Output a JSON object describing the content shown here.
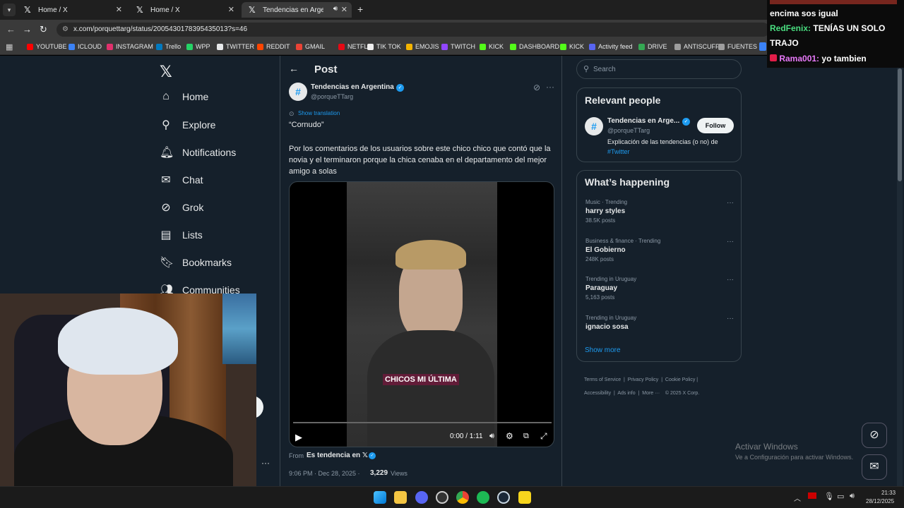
{
  "browser": {
    "tabs": [
      {
        "title": "Home / X",
        "icon": "x-logo"
      },
      {
        "title": "Home / X",
        "icon": "x-logo"
      },
      {
        "title": "Tendencias en Argentina on",
        "icon": "x-logo",
        "active": true
      }
    ],
    "new_tab": "+",
    "url": "x.com/porquettarg/status/2005430178395435013?s=46",
    "bookmarks": [
      {
        "label": "YOUTUBE",
        "color": "#ff0000"
      },
      {
        "label": "ICLOUD",
        "color": "#3b82f6"
      },
      {
        "label": "INSTAGRAM",
        "color": "#e1306c"
      },
      {
        "label": "Trello",
        "color": "#0079bf"
      },
      {
        "label": "WPP",
        "color": "#25d366"
      },
      {
        "label": "TWITTER",
        "color": "#e7e9ea"
      },
      {
        "label": "REDDIT",
        "color": "#ff4500"
      },
      {
        "label": "GMAIL",
        "color": "#ea4335"
      },
      {
        "label": "NETFLIX",
        "color": "#e50914"
      },
      {
        "label": "TIK TOK",
        "color": "#eeeeee"
      },
      {
        "label": "EMOJIS",
        "color": "#f4b400"
      },
      {
        "label": "TWITCH",
        "color": "#9146ff"
      },
      {
        "label": "KICK",
        "color": "#53fc18"
      },
      {
        "label": "DASHBOARD",
        "color": "#53fc18"
      },
      {
        "label": "KICK",
        "color": "#53fc18"
      },
      {
        "label": "Activity feed",
        "color": "#5865f2"
      },
      {
        "label": "DRIVE",
        "color": "#34a853"
      },
      {
        "label": "ANTISCUFF",
        "color": "#9e9e9e"
      },
      {
        "label": "FUENTES",
        "color": "#9e9e9e"
      }
    ]
  },
  "sidebar": {
    "items": [
      {
        "label": "Home",
        "icon": "home-icon"
      },
      {
        "label": "Explore",
        "icon": "search-icon"
      },
      {
        "label": "Notifications",
        "icon": "bell-icon"
      },
      {
        "label": "Chat",
        "icon": "mail-icon"
      },
      {
        "label": "Grok",
        "icon": "grok-icon"
      },
      {
        "label": "Lists",
        "icon": "list-icon"
      },
      {
        "label": "Bookmarks",
        "icon": "bookmark-icon"
      },
      {
        "label": "Communities",
        "icon": "people-icon"
      }
    ],
    "more": "···"
  },
  "post": {
    "header": "Post",
    "author_name": "Tendencias en Argentina",
    "author_handle": "@porqueTTarg",
    "show_translation": "Show translation",
    "text_title": "“Cornudo”",
    "text_body": "Por los comentarios de los usuarios sobre este chico chico que contó que la novia y el terminaron porque la chica cenaba en el departamento del mejor amigo a solas",
    "video_caption": "CHICOS MI ÚLTIMA",
    "video_time": "0:00 / 1:11",
    "video_progress": 0.0,
    "from_label": "From",
    "from_source": "Es tendencia en 𝕏",
    "timestamp": "9:06 PM · Dec 28, 2025 ·",
    "views_count": "3,229",
    "views_label": "Views"
  },
  "right": {
    "search_placeholder": "Search",
    "relevant_title": "Relevant people",
    "person_name": "Tendencias en Arge...",
    "person_handle": "@porqueTTarg",
    "person_bio": "Explicación de las tendencias (o no) de",
    "person_bio_link": "#Twitter",
    "follow_label": "Follow",
    "happening_title": "What’s happening",
    "trends": [
      {
        "category": "Music · Trending",
        "name": "harry styles",
        "count": "38.5K posts"
      },
      {
        "category": "Business & finance · Trending",
        "name": "El Gobierno",
        "count": "248K posts"
      },
      {
        "category": "Trending in Uruguay",
        "name": "Paraguay",
        "count": "5,163 posts"
      },
      {
        "category": "Trending in Uruguay",
        "name": "ignacio sosa",
        "count": ""
      }
    ],
    "show_more": "Show more",
    "footer": [
      "Terms of Service",
      "Privacy Policy",
      "Cookie Policy",
      "Accessibility",
      "Ads info",
      "More ···",
      "© 2025 X Corp."
    ]
  },
  "windows": {
    "activate_title": "Activar Windows",
    "activate_sub": "Ve a Configuración para activar Windows.",
    "clock_time": "21:33",
    "clock_date": "28/12/2025"
  },
  "chat": {
    "line0": "encima sos igual",
    "line1_user": "RedFenix:",
    "line1_msg": "TENÍAS UN SOLO",
    "line2": "TRAJO",
    "line3_user": "Rama001:",
    "line3_msg": "yo tambien"
  },
  "colors": {
    "accent": "#1d9bf0",
    "bg": "#15202b",
    "border": "#38444d",
    "muted": "#8b98a5",
    "redfenix": "#4ade80",
    "rama": "#e879f9"
  }
}
